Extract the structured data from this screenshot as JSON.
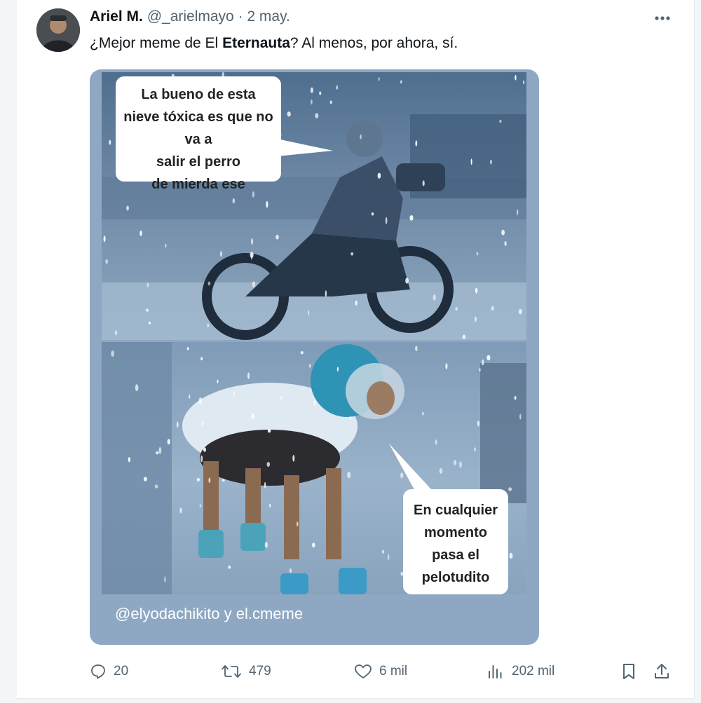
{
  "tweet": {
    "author_name": "Ariel M.",
    "handle": "@_arielmayo",
    "separator": "·",
    "date": "2 may.",
    "text_before": "¿Mejor meme de El ",
    "text_bold": "Eternauta",
    "text_after": "? Al menos, por ahora, sí."
  },
  "media": {
    "bubble_top_lines": [
      "La bueno de esta",
      "nieve tóxica es que no va a",
      "salir el perro",
      "de mierda ese"
    ],
    "bubble_bottom_lines": [
      "En cualquier",
      "momento",
      "pasa el",
      "pelotudito"
    ],
    "credit": "@elyodachikito y el.cmeme"
  },
  "actions": {
    "replies": "20",
    "reposts": "479",
    "likes": "6 mil",
    "views": "202 mil"
  },
  "icons": {
    "more": "more-horizontal-icon",
    "reply": "reply-icon",
    "repost": "repost-icon",
    "like": "heart-icon",
    "views": "views-chart-icon",
    "bookmark": "bookmark-icon",
    "share": "share-icon"
  },
  "colors": {
    "secondary_text": "#536471",
    "media_border": "#8ea8c3"
  }
}
